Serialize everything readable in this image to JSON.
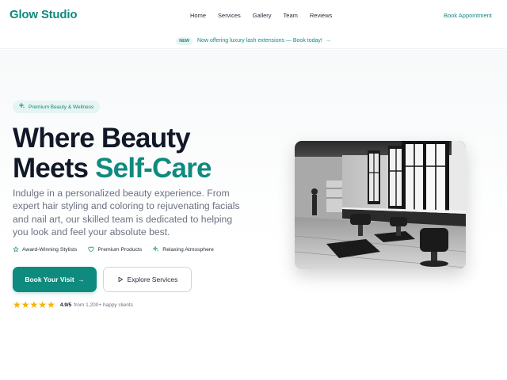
{
  "header": {
    "logo": "Glow Studio",
    "nav": [
      "Home",
      "Services",
      "Gallery",
      "Team",
      "Reviews"
    ],
    "cta": "Book Appointment"
  },
  "announcement": {
    "badge": "NEW",
    "text": "Now offering luxury lash extensions — Book today!",
    "arrow_icon": "arrow-right-icon"
  },
  "hero": {
    "pill": "Premium Beauty & Wellness",
    "pill_icon": "sparkle-icon",
    "title_line1": "Where Beauty",
    "title_line2_prefix": "Meets ",
    "title_line2_accent": "Self-Care",
    "description": "Indulge in a personalized beauty experience. From expert hair styling and coloring to rejuvenating facials and nail art, our skilled team is dedicated to helping you look and feel your absolute best.",
    "features": [
      {
        "label": "Award-Winning Stylists",
        "icon": "star-outline-icon"
      },
      {
        "label": "Premium Products",
        "icon": "heart-outline-icon"
      },
      {
        "label": "Relaxing Atmosphere",
        "icon": "sparkle-icon"
      }
    ],
    "primary_button": "Book Your Visit",
    "secondary_button": "Explore Services",
    "rating": {
      "stars": 5,
      "score": "4.9/5",
      "caption": "from 1,200+ happy clients"
    }
  },
  "colors": {
    "brand": "#0f8a7e",
    "brand_light": "#e6f4f2",
    "star": "#f5b301",
    "text_dark": "#111827",
    "text_muted": "#6b7280"
  }
}
